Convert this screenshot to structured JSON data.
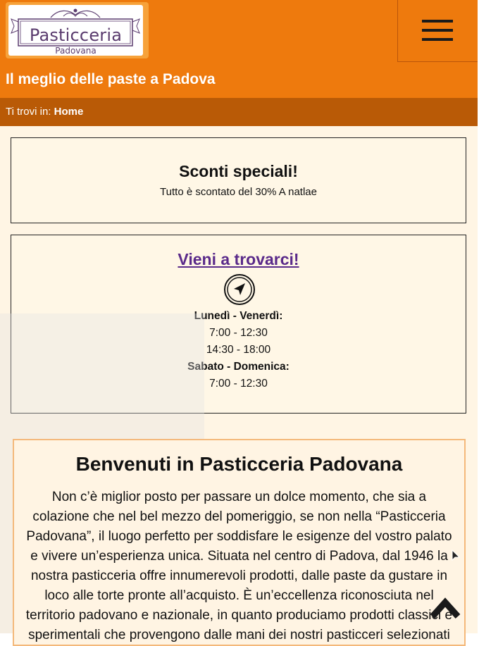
{
  "header": {
    "logo": {
      "title": "Pasticceria",
      "subtitle": "Padovana"
    },
    "tagline": "Il meglio delle paste a Padova",
    "menu_icon": "hamburger-menu-icon"
  },
  "breadcrumb": {
    "prefix": "Ti trovi in:",
    "current": "Home"
  },
  "promo": {
    "title": "Sconti speciali!",
    "text": "Tutto è scontato del 30% A natlae"
  },
  "visit": {
    "title": "Vieni a trovarci!",
    "icon": "navigation-arrow-icon",
    "hours": [
      {
        "label": "Lunedì - Venerdì:",
        "times": [
          "7:00 - 12:30",
          "14:30 - 18:00"
        ]
      },
      {
        "label": "Sabato - Domenica:",
        "times": [
          "7:00 - 12:30"
        ]
      }
    ]
  },
  "welcome": {
    "title": "Benvenuti in Pasticceria Padovana",
    "body": "Non c’è miglior posto per passare un dolce momento, che sia a colazione che nel bel mezzo del pomeriggio, se non nella “Pasticceria Padovana”, il luogo perfetto per soddisfare le esigenze del vostro palato e vivere un’esperienza unica. Situata nel centro di Padova, dal 1946 la nostra pasticceria offre innumerevoli prodotti, dalle paste da gustare in loco alle torte pronte all’acquisto. È un’eccellenza riconosciuta nel territorio padovano e nazionale, in quanto produciamo prodotti classici e sperimentali che provengono dalle mani dei nostri pasticceri selezionati"
  },
  "scroll_top_icon": "chevron-up-icon",
  "colors": {
    "header": "#ee7a0d",
    "breadcrumb": "#b95a06",
    "content_bg": "#fff5e4",
    "link": "#5a2a8a",
    "welcome_border": "#f4b87a"
  }
}
